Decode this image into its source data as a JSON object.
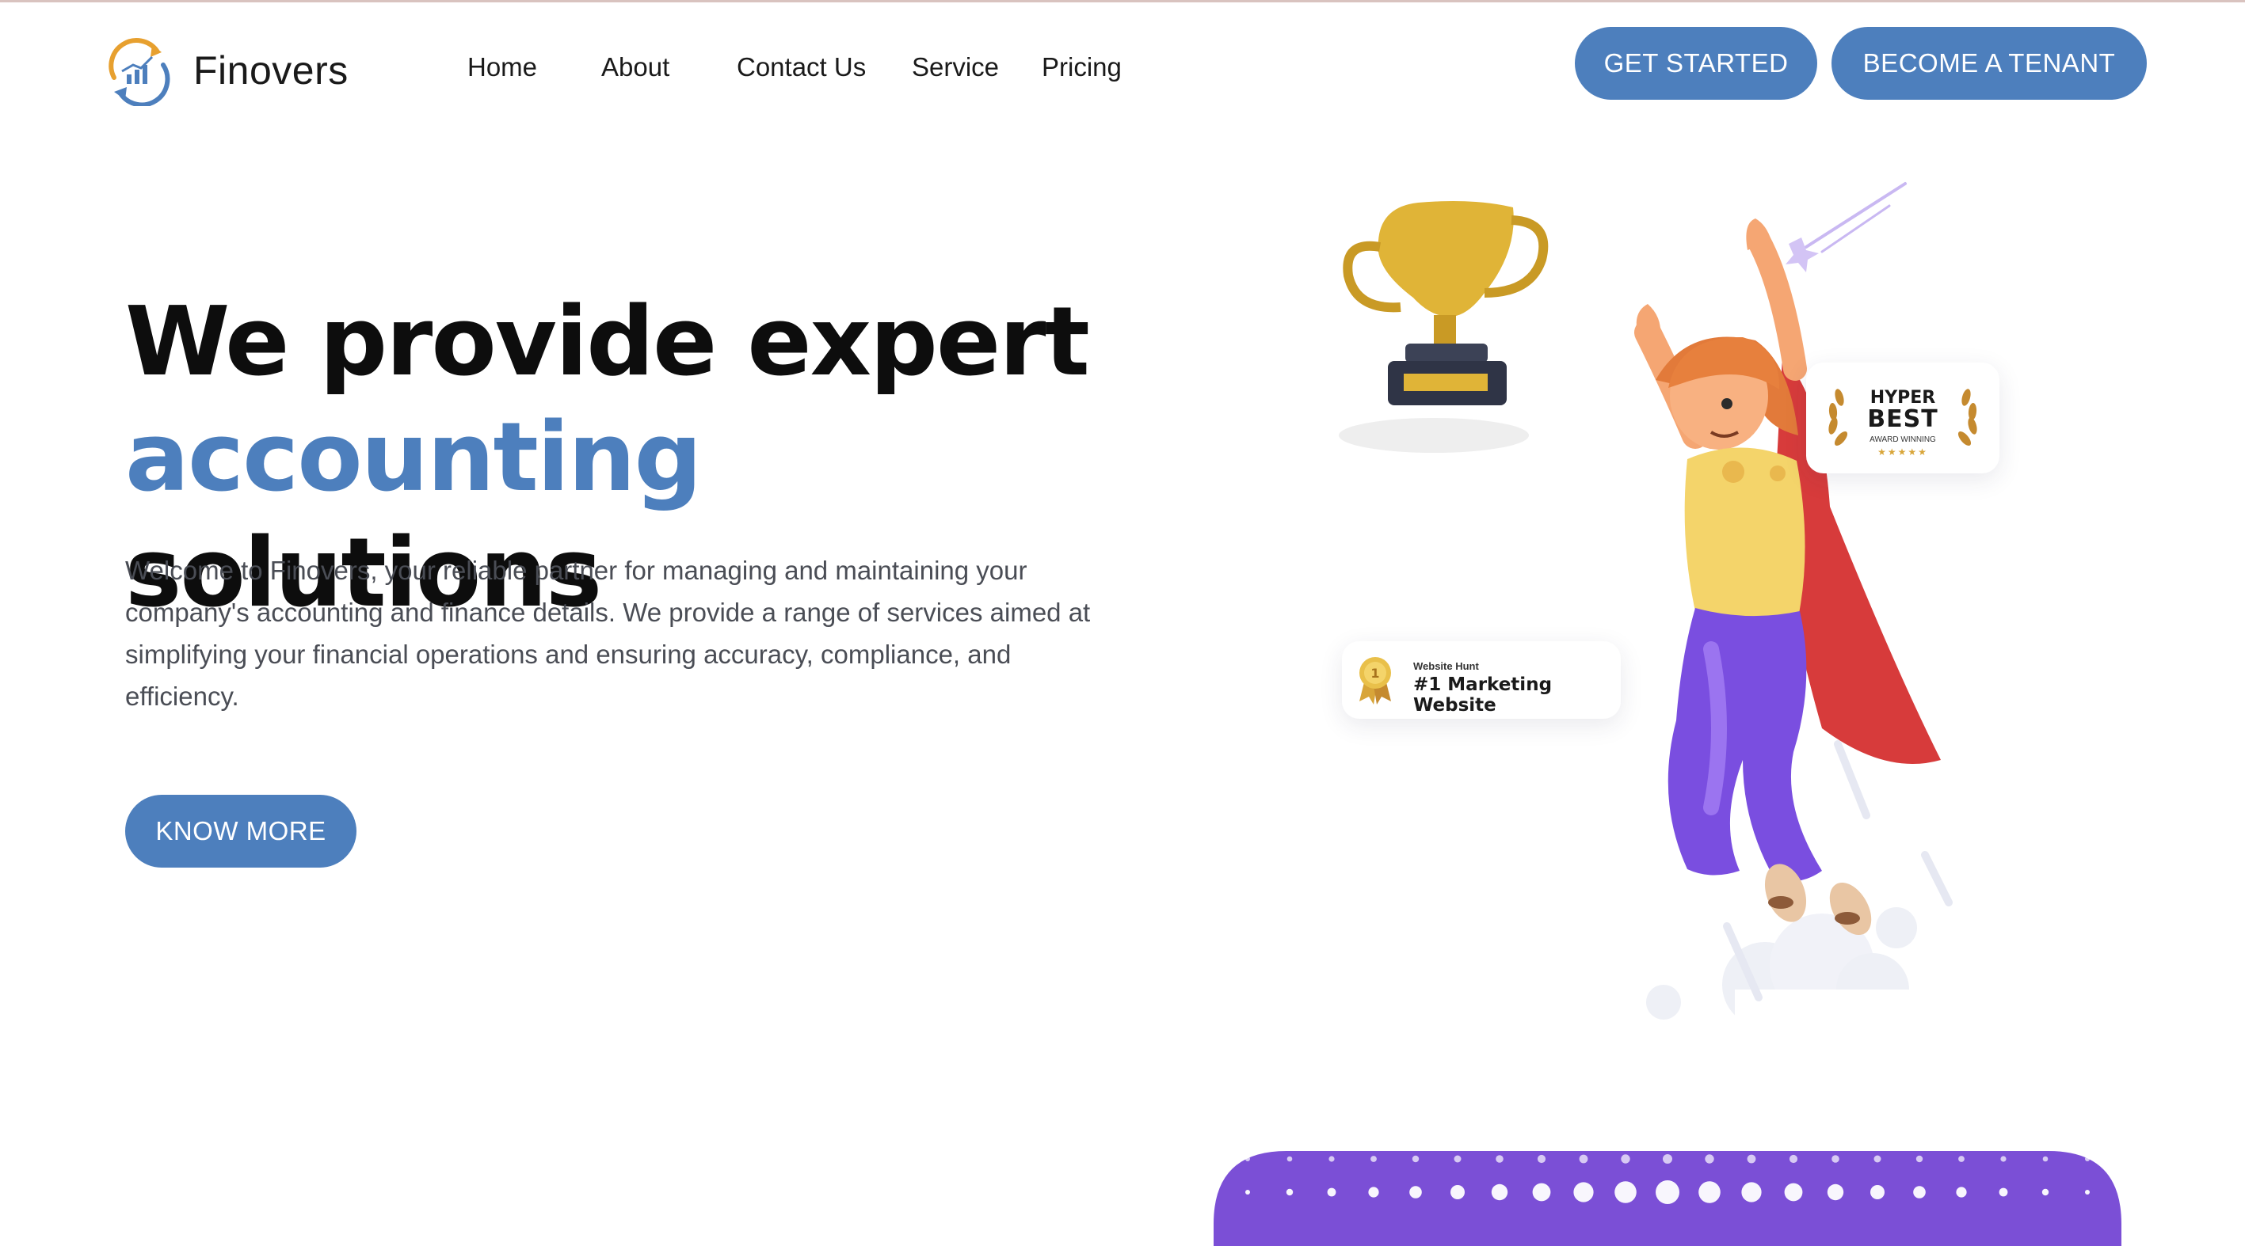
{
  "header": {
    "brand": "Finovers",
    "nav": [
      "Home",
      "About",
      "Contact Us",
      "Service",
      "Pricing"
    ],
    "get_started": "GET STARTED",
    "become_tenant": "BECOME A TENANT"
  },
  "hero": {
    "title_line1": "We provide expert",
    "title_accent": "accounting",
    "title_rest": " solutions",
    "description": "Welcome to Finovers, your reliable partner for managing and maintaining your company's accounting and finance details. We provide a range of services aimed at simplifying your financial operations and ensuring accuracy, compliance, and efficiency.",
    "cta": "KNOW MORE"
  },
  "badges": {
    "hyper_line1": "HYPER",
    "hyper_line2": "BEST",
    "hyper_line3": "AWARD WINNING",
    "hyper_stars": "★★★★★",
    "hunt_small": "Website Hunt",
    "hunt_title": "#1 Marketing Website",
    "hunt_rank": "1"
  },
  "colors": {
    "accent": "#4d7fbd",
    "band": "#7b4fd6",
    "cape": "#d73b3b",
    "pants": "#7a4ee0",
    "shirt": "#f4d46a",
    "hair": "#e27a3a",
    "trophy": "#e0b437"
  }
}
